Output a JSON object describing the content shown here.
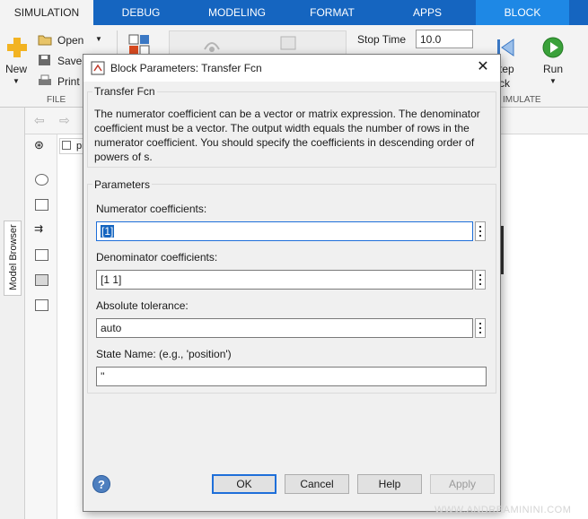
{
  "ribbon": {
    "tabs": [
      {
        "label": "SIMULATION"
      },
      {
        "label": "DEBUG"
      },
      {
        "label": "MODELING"
      },
      {
        "label": "FORMAT"
      },
      {
        "label": "APPS"
      },
      {
        "label": "BLOCK"
      }
    ],
    "active_tab": "SIMULATION",
    "new_label": "New",
    "open_label": "Open",
    "save_label": "Save",
    "print_label": "Print",
    "file_section_label": "FILE",
    "stop_time_label": "Stop Time",
    "stop_time_value": "10.0",
    "step_label_line1": "tep",
    "step_label_line2": "ck",
    "run_label": "Run",
    "simulate_section_label": "IMULATE"
  },
  "side": {
    "model_browser_label": "Model Browser",
    "breadcrumb_fragment": "pr"
  },
  "dialog": {
    "title": "Block Parameters: Transfer Fcn",
    "block_type": "Transfer Fcn",
    "description": "The numerator coefficient can be a vector or matrix expression. The denominator coefficient must be a vector. The output width equals the number of rows in the numerator coefficient. You should specify the coefficients in descending order of powers of s.",
    "parameters_title": "Parameters",
    "fields": [
      {
        "label": "Numerator coefficients:",
        "value": "[1]"
      },
      {
        "label": "Denominator coefficients:",
        "value": "[1 1]"
      },
      {
        "label": "Absolute tolerance:",
        "value": "auto"
      },
      {
        "label": "State Name: (e.g., 'position')",
        "value": "''"
      }
    ],
    "buttons": {
      "ok": "OK",
      "cancel": "Cancel",
      "help": "Help",
      "apply": "Apply"
    }
  },
  "watermark": "WWW.ANDREAMININI.COM",
  "colors": {
    "ribbon_blue": "#1565c0",
    "block_tab_blue": "#1e88e5",
    "focus_blue": "#1e6fd9",
    "run_green": "#3aa13a"
  }
}
